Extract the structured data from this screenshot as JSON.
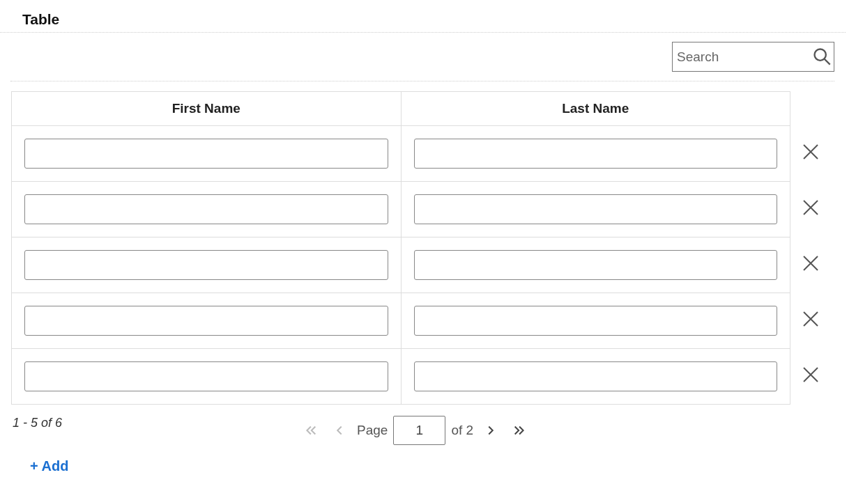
{
  "title": "Table",
  "search": {
    "placeholder": "Search"
  },
  "table": {
    "columns": [
      "First Name",
      "Last Name"
    ],
    "rows": [
      {
        "kind": "input-row"
      },
      {
        "kind": "input-row"
      },
      {
        "kind": "input-row"
      },
      {
        "kind": "input-row"
      },
      {
        "kind": "input-row"
      }
    ]
  },
  "summary": "1 - 5 of 6",
  "pager": {
    "buttons_before": [
      {
        "kind": "first",
        "disabled": true
      },
      {
        "kind": "prev",
        "disabled": true
      }
    ],
    "page_label": "Page",
    "page_value": "1",
    "of_label": "of 2",
    "buttons_after": [
      {
        "kind": "next",
        "disabled": false
      },
      {
        "kind": "last",
        "disabled": false
      }
    ]
  },
  "add_link": "+ Add"
}
